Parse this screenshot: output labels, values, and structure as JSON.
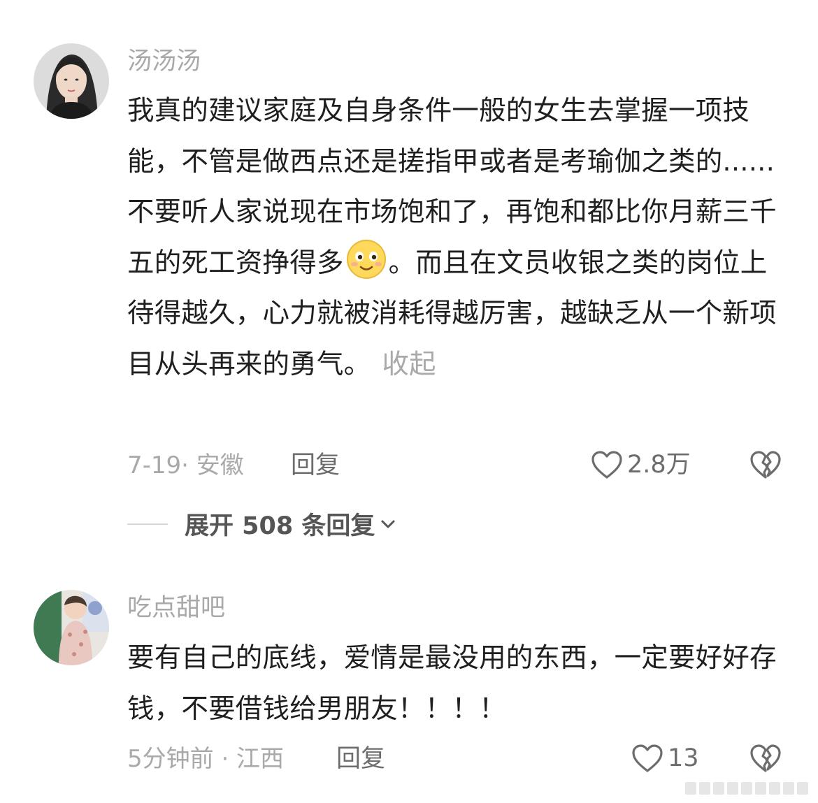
{
  "comments": [
    {
      "username": "汤汤汤",
      "text_before_emoji": "我真的建议家庭及自身条件一般的女生去掌握一项技能，不管是做西点还是搓指甲或者是考瑜伽之类的......不要听人家说现在市场饱和了，再饱和都比你月薪三千五的死工资挣得多",
      "emoji_icon": "smiling-face-emoji",
      "text_after_emoji": "。而且在文员收银之类的岗位上待得越久，心力就被消耗得越厉害，越缺乏从一个新项目从头再来的勇气。",
      "collapse_label": "收起",
      "meta": "7-19· 安徽",
      "reply_label": "回复",
      "like_icon": "heart-outline-icon",
      "like_count": "2.8万",
      "dislike_icon": "broken-heart-icon",
      "expand_replies_label": "展开 508 条回复",
      "expand_icon": "chevron-down-icon"
    },
    {
      "username": "吃点甜吧",
      "text": "要有自己的底线，爱情是最没用的东西，一定要好好存钱，不要借钱给男朋友！！！！",
      "meta": "5分钟前 · 江西",
      "reply_label": "回复",
      "like_icon": "heart-outline-icon",
      "like_count": "13",
      "dislike_icon": "broken-heart-icon"
    }
  ],
  "colors": {
    "text_primary": "#1f1f1f",
    "text_secondary": "#a9a9a9",
    "action_gray": "#6c6c6c",
    "background": "#ffffff"
  }
}
